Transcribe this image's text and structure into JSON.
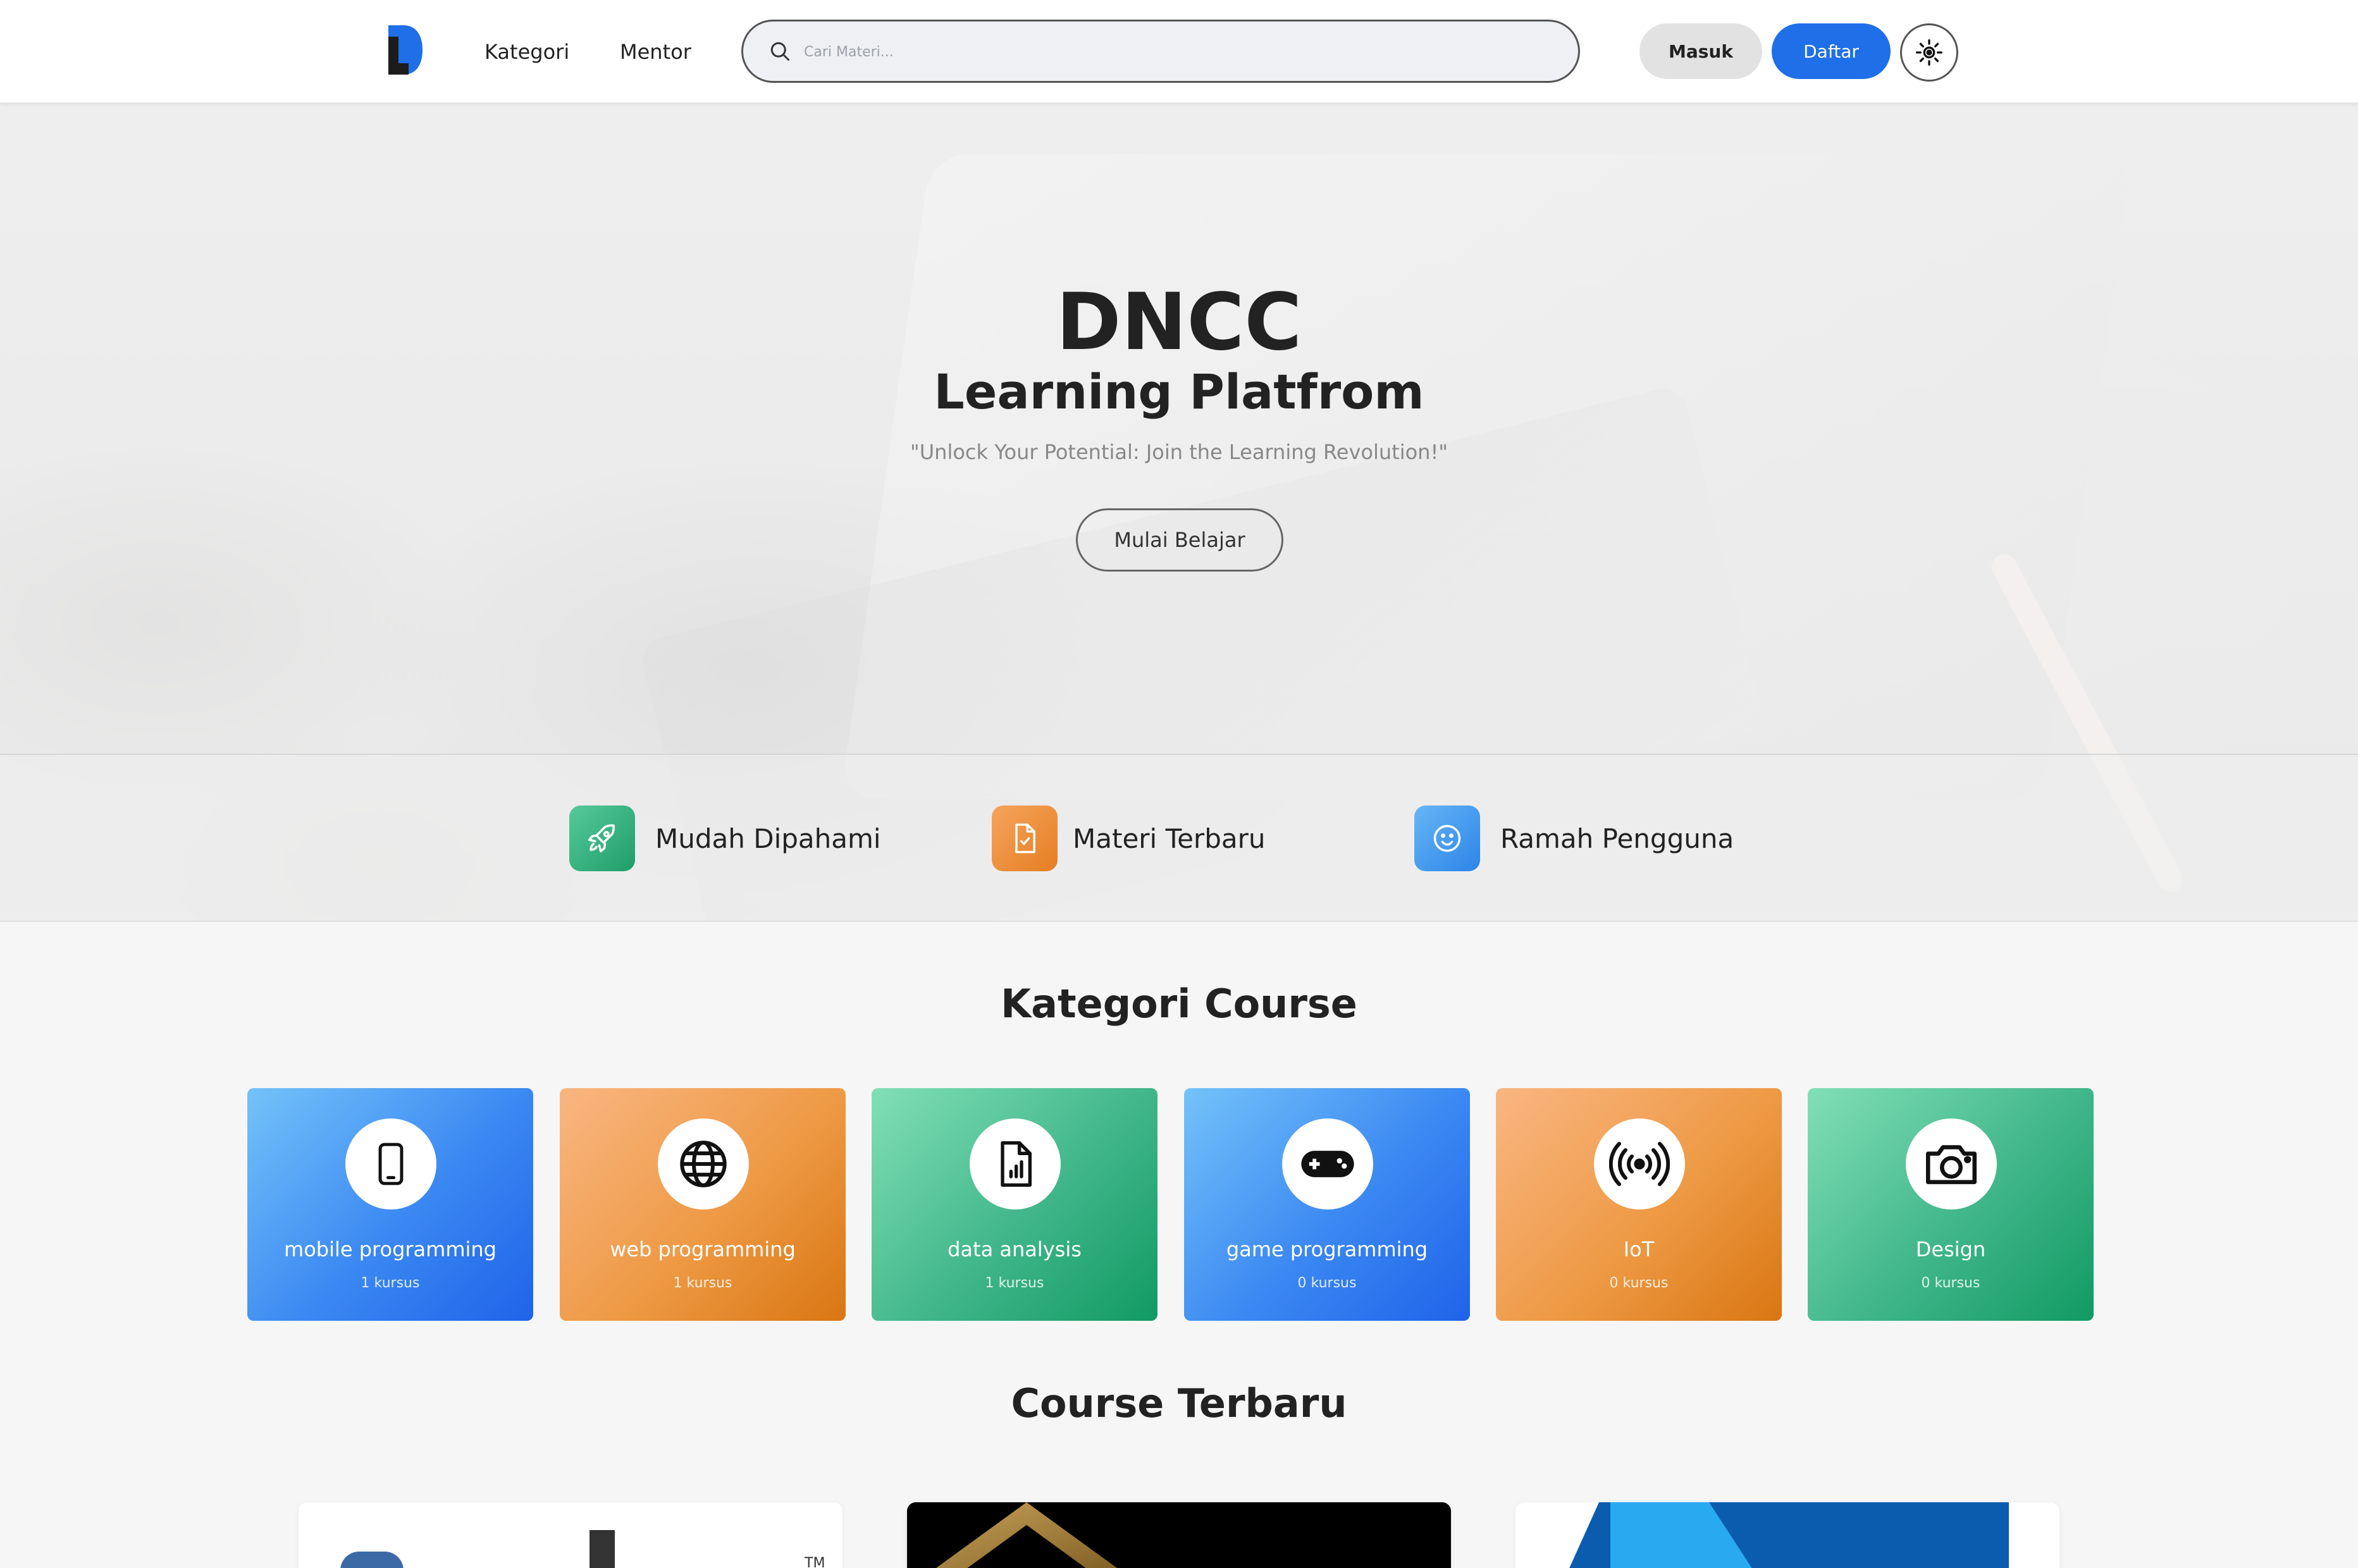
{
  "nav": {
    "links": [
      "Kategori",
      "Mentor"
    ],
    "search_placeholder": "Cari Materi...",
    "login_label": "Masuk",
    "register_label": "Daftar"
  },
  "hero": {
    "title": "DNCC",
    "subtitle": "Learning Platfrom",
    "tagline": "\"Unlock Your Potential: Join the Learning Revolution!\"",
    "cta_label": "Mulai Belajar"
  },
  "features": [
    {
      "label": "Mudah Dipahami",
      "icon": "rocket-icon"
    },
    {
      "label": "Materi Terbaru",
      "icon": "document-check-icon"
    },
    {
      "label": "Ramah Pengguna",
      "icon": "smiley-icon"
    }
  ],
  "categories_section": {
    "title": "Kategori Course",
    "items": [
      {
        "name": "mobile programming",
        "count": "1 kursus",
        "icon": "smartphone-icon",
        "color": "blue"
      },
      {
        "name": "web programming",
        "count": "1 kursus",
        "icon": "globe-icon",
        "color": "orange"
      },
      {
        "name": "data analysis",
        "count": "1 kursus",
        "icon": "chart-document-icon",
        "color": "green"
      },
      {
        "name": "game programming",
        "count": "0 kursus",
        "icon": "gamepad-icon",
        "color": "blue"
      },
      {
        "name": "IoT",
        "count": "0 kursus",
        "icon": "broadcast-icon",
        "color": "orange"
      },
      {
        "name": "Design",
        "count": "0 kursus",
        "icon": "camera-icon",
        "color": "green"
      }
    ]
  },
  "courses_section": {
    "title": "Course Terbaru",
    "tm_mark": "TM"
  },
  "colors": {
    "primary": "#1f6fe8",
    "blue_gradient": [
      "#74c3f9",
      "#1f63e9"
    ],
    "orange_gradient": [
      "#f9b682",
      "#d97612"
    ],
    "green_gradient": [
      "#82dfb7",
      "#119a63"
    ]
  }
}
